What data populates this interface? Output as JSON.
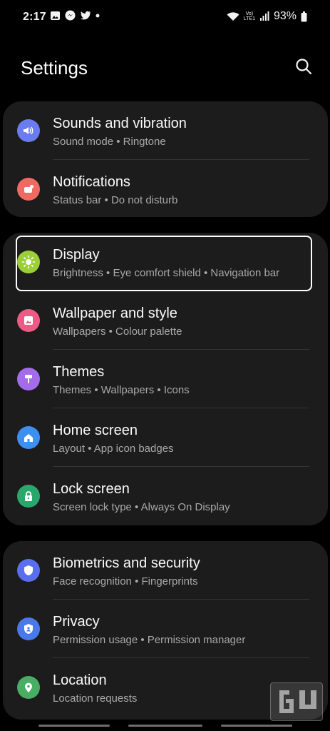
{
  "status": {
    "time": "2:17",
    "volte": "Vo)\nLTE1",
    "battery": "93%"
  },
  "header": {
    "title": "Settings"
  },
  "colors": {
    "background": "#000000",
    "card": "#1c1c1c",
    "subtitle": "#a9a9a9"
  },
  "groups": [
    {
      "items": [
        {
          "title": "Sounds and vibration",
          "subtitle": "Sound mode  •  Ringtone",
          "icon": "speaker-icon",
          "color": "#6b7bf0"
        },
        {
          "title": "Notifications",
          "subtitle": "Status bar  •  Do not disturb",
          "icon": "notification-icon",
          "color": "#f06a62"
        }
      ]
    },
    {
      "items": [
        {
          "title": "Display",
          "subtitle": "Brightness  •  Eye comfort shield  •  Navigation bar",
          "icon": "sun-icon",
          "color": "#9ccf37"
        },
        {
          "title": "Wallpaper and style",
          "subtitle": "Wallpapers  •  Colour palette",
          "icon": "image-icon",
          "color": "#ee5a86"
        },
        {
          "title": "Themes",
          "subtitle": "Themes  •  Wallpapers  •  Icons",
          "icon": "brush-icon",
          "color": "#a46cea"
        },
        {
          "title": "Home screen",
          "subtitle": "Layout  •  App icon badges",
          "icon": "home-icon",
          "color": "#3d8ff0"
        },
        {
          "title": "Lock screen",
          "subtitle": "Screen lock type  •  Always On Display",
          "icon": "lock-icon",
          "color": "#2aa86b"
        }
      ]
    },
    {
      "items": [
        {
          "title": "Biometrics and security",
          "subtitle": "Face recognition  •  Fingerprints",
          "icon": "shield-icon",
          "color": "#5a6ff0"
        },
        {
          "title": "Privacy",
          "subtitle": "Permission usage  •  Permission manager",
          "icon": "privacy-icon",
          "color": "#4a79ea"
        },
        {
          "title": "Location",
          "subtitle": "Location requests",
          "icon": "location-icon",
          "color": "#48ae63"
        }
      ]
    }
  ]
}
